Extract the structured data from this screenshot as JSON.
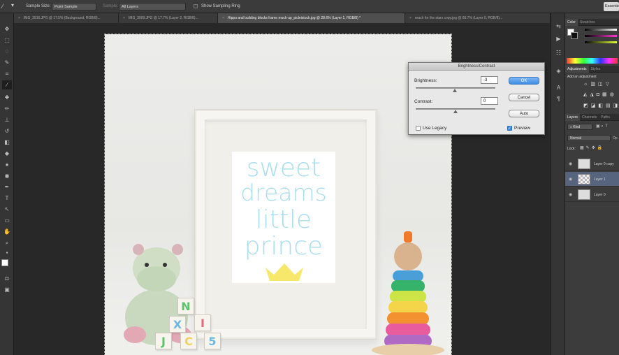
{
  "options_bar": {
    "sample_size_label": "Sample Size:",
    "sample_size_value": "Point Sample",
    "sample_label": "Sample:",
    "sample_value": "All Layers",
    "show_ring_label": "Show Sampling Ring",
    "workspace": "Essentials"
  },
  "tabs": [
    {
      "label": "IMG_3916.JPG @ 17.5% (Background, RGB/8)...",
      "active": false
    },
    {
      "label": "IMG_3909.JPG @ 17.7% (Layer 2, RGB/8)...",
      "active": false
    },
    {
      "label": "Hippo and building blocks frame mock-up_picleistock.jpg @ 28.6% (Layer 1, RGB/8) *",
      "active": true
    },
    {
      "label": "reach for the stars copy.jpg @ 66.7% (Layer 0, RGB/8)...",
      "active": false
    }
  ],
  "artwork": {
    "lines": [
      "sweet",
      "dreams",
      "little",
      "prince"
    ],
    "blocks": [
      "N",
      "X",
      "I",
      "J",
      "C",
      "5"
    ],
    "text_color": "#a9def0",
    "crown_color": "#f7e76a"
  },
  "dialog": {
    "title": "Brightness/Contrast",
    "brightness_label": "Brightness:",
    "brightness_value": "-3",
    "contrast_label": "Contrast:",
    "contrast_value": "0",
    "ok": "OK",
    "cancel": "Cancel",
    "auto": "Auto",
    "legacy": "Use Legacy",
    "preview": "Preview",
    "brightness_level": 0.49,
    "contrast_level": 0.5
  },
  "panels": {
    "color_tabs": [
      "Color",
      "Swatches"
    ],
    "adjust_tabs": [
      "Adjustments",
      "Styles"
    ],
    "add_adjustment": "Add an adjustment",
    "layer_tabs": [
      "Layers",
      "Channels",
      "Paths"
    ],
    "kind": "Kind",
    "blend_mode": "Normal",
    "opacity_label": "Op",
    "lock_label": "Lock:",
    "layers": [
      {
        "name": "Layer 0 copy",
        "selected": false
      },
      {
        "name": "Layer 1",
        "selected": true
      },
      {
        "name": "Layer 0",
        "selected": false
      }
    ]
  }
}
